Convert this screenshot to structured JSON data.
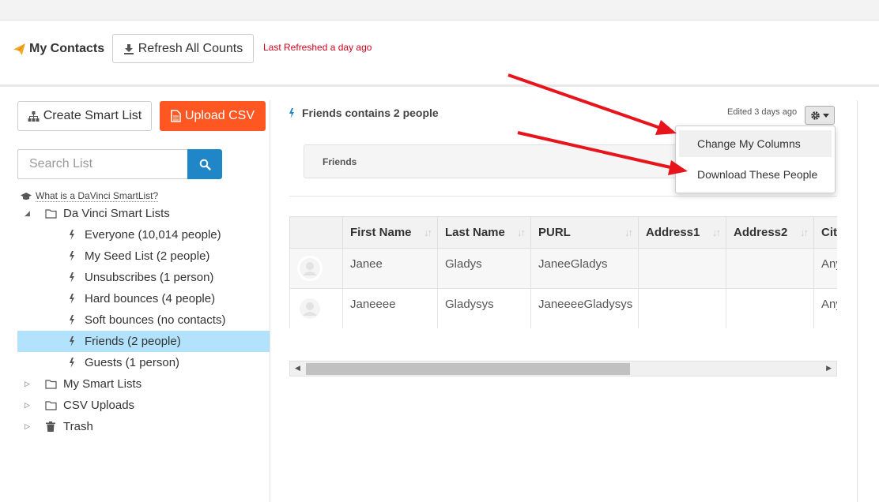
{
  "header": {
    "title": "My Contacts",
    "refresh_label": "Refresh All Counts",
    "last_refreshed": "Last Refreshed a day ago"
  },
  "sidebar": {
    "create_label": "Create Smart List",
    "upload_label": "Upload CSV",
    "search_placeholder": "Search List",
    "what_is_link": "What is a DaVinci SmartList?",
    "tree": {
      "root_label": "Da Vinci Smart Lists",
      "items": [
        "Everyone (10,014 people)",
        "My Seed List (2 people)",
        "Unsubscribes (1 person)",
        "Hard bounces (4 people)",
        "Soft bounces (no contacts)",
        "Friends (2 people)",
        "Guests (1 person)"
      ],
      "selected_item": "Friends (2 people)",
      "folders": [
        "My Smart Lists",
        "CSV Uploads",
        "Trash"
      ]
    }
  },
  "main": {
    "title": "Friends contains 2 people",
    "edited": "Edited 3 days ago",
    "filter_label": "Friends",
    "dropdown": [
      "Change My Columns",
      "Download These People"
    ],
    "table": {
      "columns": [
        "First Name",
        "Last Name",
        "PURL",
        "Address1",
        "Address2",
        "Cit"
      ],
      "rows": [
        [
          "Janee",
          "Gladys",
          "JaneeGladys",
          "",
          "",
          "Any"
        ],
        [
          "Janeeee",
          "Gladysys",
          "JaneeeeGladysys",
          "",
          "",
          "Any"
        ]
      ]
    }
  },
  "colors": {
    "accent_orange": "#ff5722",
    "search_blue": "#1f86c7",
    "selected_row": "#b3e3fc",
    "alert_red": "#d0021b",
    "annotation_arrow": "#e8141b"
  }
}
